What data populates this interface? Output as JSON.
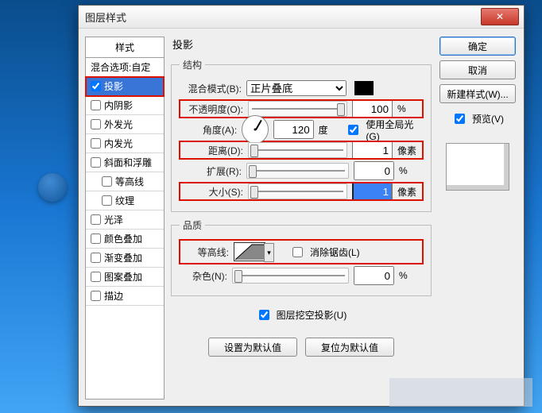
{
  "window": {
    "title": "图层样式"
  },
  "sidebar": {
    "header": "样式",
    "items": [
      {
        "label": "混合选项:自定",
        "checkbox": false
      },
      {
        "label": "投影",
        "checkbox": true,
        "checked": true,
        "selected": true
      },
      {
        "label": "内阴影",
        "checkbox": true,
        "checked": false
      },
      {
        "label": "外发光",
        "checkbox": true,
        "checked": false
      },
      {
        "label": "内发光",
        "checkbox": true,
        "checked": false
      },
      {
        "label": "斜面和浮雕",
        "checkbox": true,
        "checked": false
      },
      {
        "label": "等高线",
        "checkbox": true,
        "checked": false,
        "indent": true
      },
      {
        "label": "纹理",
        "checkbox": true,
        "checked": false,
        "indent": true
      },
      {
        "label": "光泽",
        "checkbox": true,
        "checked": false
      },
      {
        "label": "颜色叠加",
        "checkbox": true,
        "checked": false
      },
      {
        "label": "渐变叠加",
        "checkbox": true,
        "checked": false
      },
      {
        "label": "图案叠加",
        "checkbox": true,
        "checked": false
      },
      {
        "label": "描边",
        "checkbox": true,
        "checked": false
      }
    ]
  },
  "main": {
    "title": "投影",
    "structure": {
      "legend": "结构",
      "blend_mode_label": "混合模式(B):",
      "blend_mode_value": "正片叠底",
      "color": "#000000",
      "opacity_label": "不透明度(O):",
      "opacity_value": "100",
      "opacity_unit": "%",
      "angle_label": "角度(A):",
      "angle_value": "120",
      "angle_unit": "度",
      "global_light_label": "使用全局光(G)",
      "global_light_checked": true,
      "distance_label": "距离(D):",
      "distance_value": "1",
      "distance_unit": "像素",
      "spread_label": "扩展(R):",
      "spread_value": "0",
      "spread_unit": "%",
      "size_label": "大小(S):",
      "size_value": "1",
      "size_unit": "像素"
    },
    "quality": {
      "legend": "品质",
      "contour_label": "等高线:",
      "antialias_label": "消除锯齿(L)",
      "antialias_checked": false,
      "noise_label": "杂色(N):",
      "noise_value": "0",
      "noise_unit": "%"
    },
    "knockout_label": "图层挖空投影(U)",
    "knockout_checked": true,
    "set_default": "设置为默认值",
    "reset_default": "复位为默认值"
  },
  "right": {
    "ok": "确定",
    "cancel": "取消",
    "new_style": "新建样式(W)...",
    "preview_label": "预览(V)",
    "preview_checked": true
  }
}
